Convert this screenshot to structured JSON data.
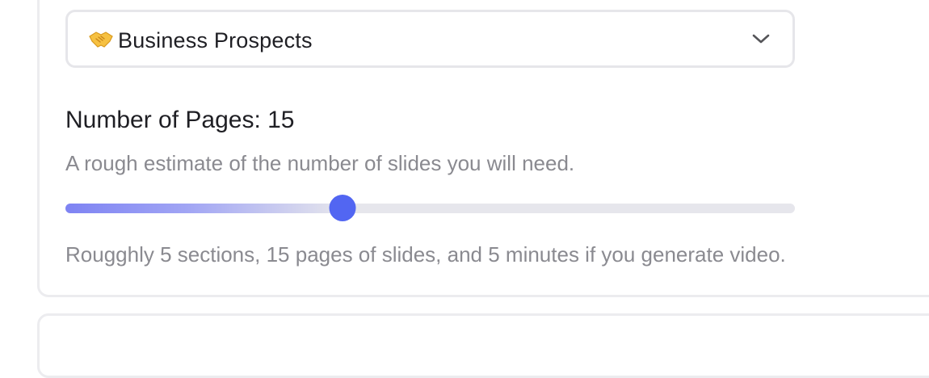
{
  "select": {
    "icon": "handshake-icon",
    "label": "Business Prospects"
  },
  "pages": {
    "title": "Number of Pages: 15",
    "value": 15,
    "fraction": 0.38,
    "description": "A rough estimate of the number of slides you will need.",
    "summary": "Rougghly 5 sections, 15 pages of slides, and 5 minutes if you generate video."
  },
  "colors": {
    "accent": "#5266f2",
    "track": "#e6e6ec",
    "muted_text": "#8a8a90",
    "border": "#ececef"
  }
}
